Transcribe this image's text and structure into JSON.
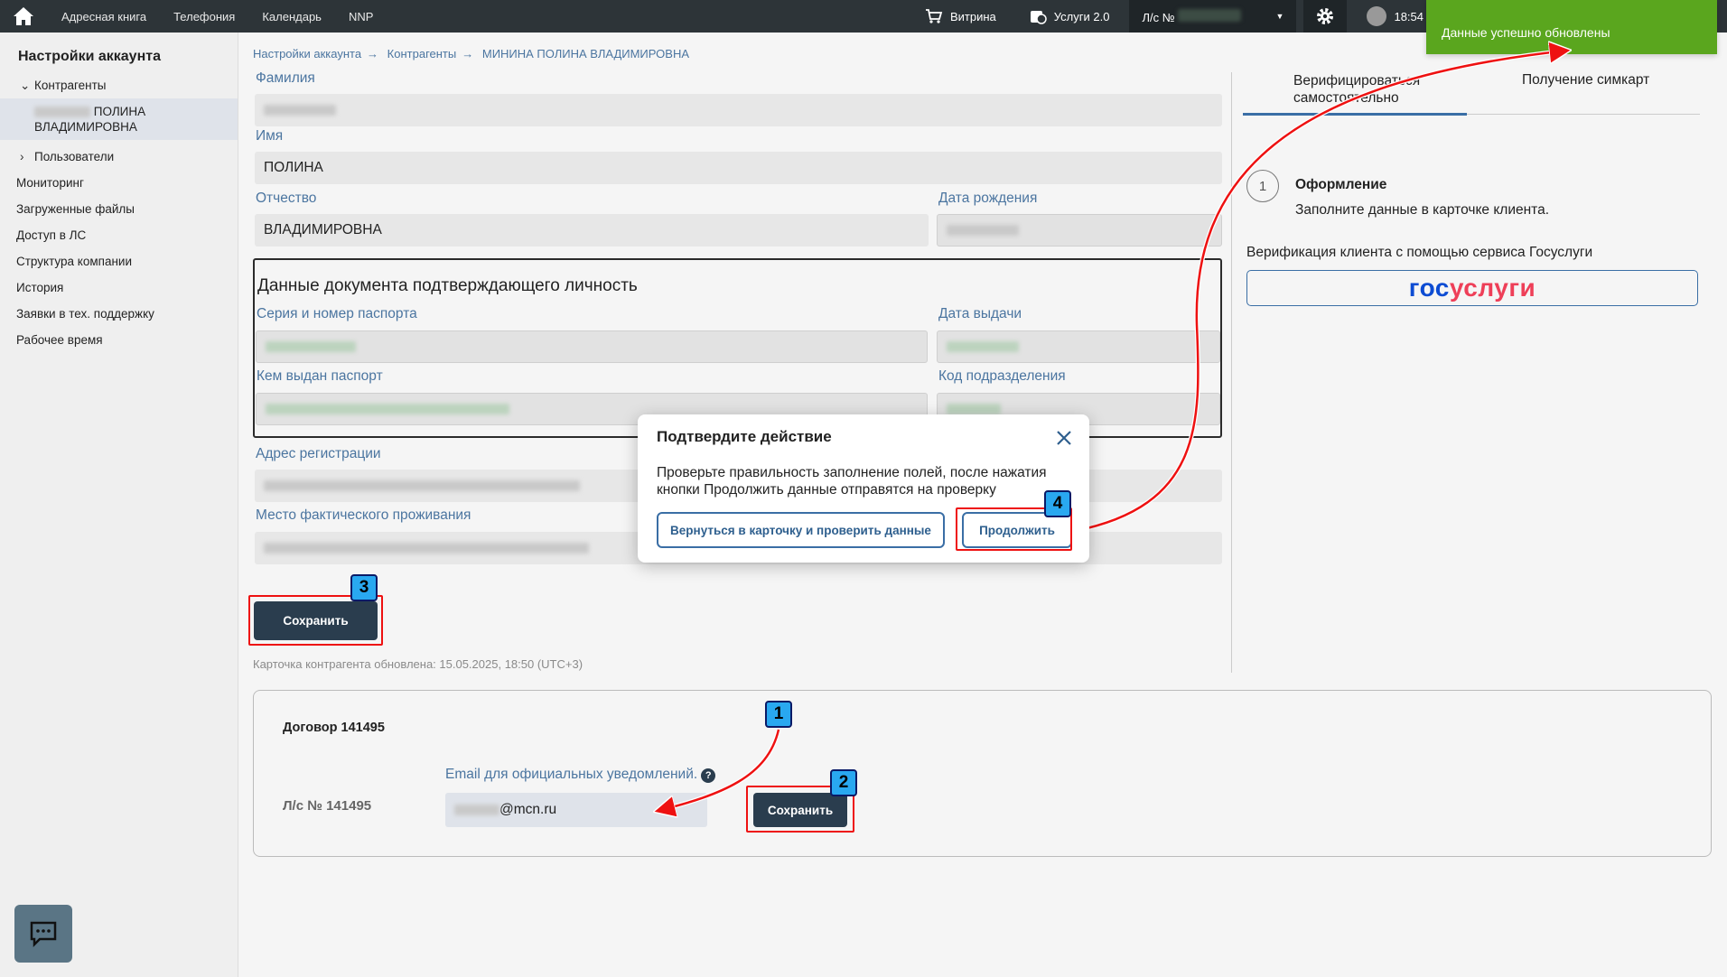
{
  "topbar": {
    "nav": [
      "Адресная книга",
      "Телефония",
      "Календарь",
      "NNP"
    ],
    "vitrina": "Витрина",
    "uslugi": "Услуги 2.0",
    "ls_label": "Л/с №",
    "time": "18:54"
  },
  "toast": {
    "text": "Данные успешно обновлены",
    "color": "#5aa61e"
  },
  "sidebar": {
    "title": "Настройки аккаунта",
    "items": [
      {
        "label": "Контрагенты"
      },
      {
        "label": "ПОЛИНА ВЛАДИМИРОВНА"
      },
      {
        "label": "Пользователи"
      },
      {
        "label": "Мониторинг"
      },
      {
        "label": "Загруженные файлы"
      },
      {
        "label": "Доступ в ЛС"
      },
      {
        "label": "Структура компании"
      },
      {
        "label": "История"
      },
      {
        "label": "Заявки в тех. поддержку"
      },
      {
        "label": "Рабочее время"
      }
    ]
  },
  "breadcrumb": [
    "Настройки аккаунта",
    "Контрагенты",
    "МИНИНА ПОЛИНА ВЛАДИМИРОВНА"
  ],
  "form": {
    "surname_label": "Фамилия",
    "name_label": "Имя",
    "name_value": "ПОЛИНА",
    "patronymic_label": "Отчество",
    "patronymic_value": "ВЛАДИМИРОВНА",
    "birth_label": "Дата рождения",
    "doc_title": "Данные документа подтверждающего личность",
    "passport_label": "Серия и номер паспорта",
    "issue_date_label": "Дата выдачи",
    "issued_by_label": "Кем выдан паспорт",
    "dept_code_label": "Код подразделения",
    "reg_address_label": "Адрес регистрации",
    "actual_address_label": "Место фактического проживания",
    "save_label": "Сохранить",
    "updated_text": "Карточка контрагента обновлена: 15.05.2025, 18:50 (UTC+3)"
  },
  "right": {
    "tab1": "Верифицироваться самостоятельно",
    "tab2": "Получение симкарт",
    "step_num": "1",
    "step_title": "Оформление",
    "step_desc": "Заполните данные в карточке клиента.",
    "gos_caption": "Верификация клиента с помощью сервиса Госуслуги",
    "gos_part1": "гос",
    "gos_part2": "услуги"
  },
  "contract": {
    "title": "Договор 141495",
    "ls": "Л/с № 141495",
    "email_label": "Email для официальных уведомлений.",
    "email_suffix": "@mcn.ru",
    "save_label": "Сохранить"
  },
  "modal": {
    "title": "Подтвердите действие",
    "text": "Проверьте правильность заполнение полей, после нажатия кнопки Продолжить данные отправятся на проверку",
    "back_label": "Вернуться в карточку и проверить данные",
    "continue_label": "Продолжить"
  },
  "badges": [
    "1",
    "2",
    "3",
    "4"
  ]
}
